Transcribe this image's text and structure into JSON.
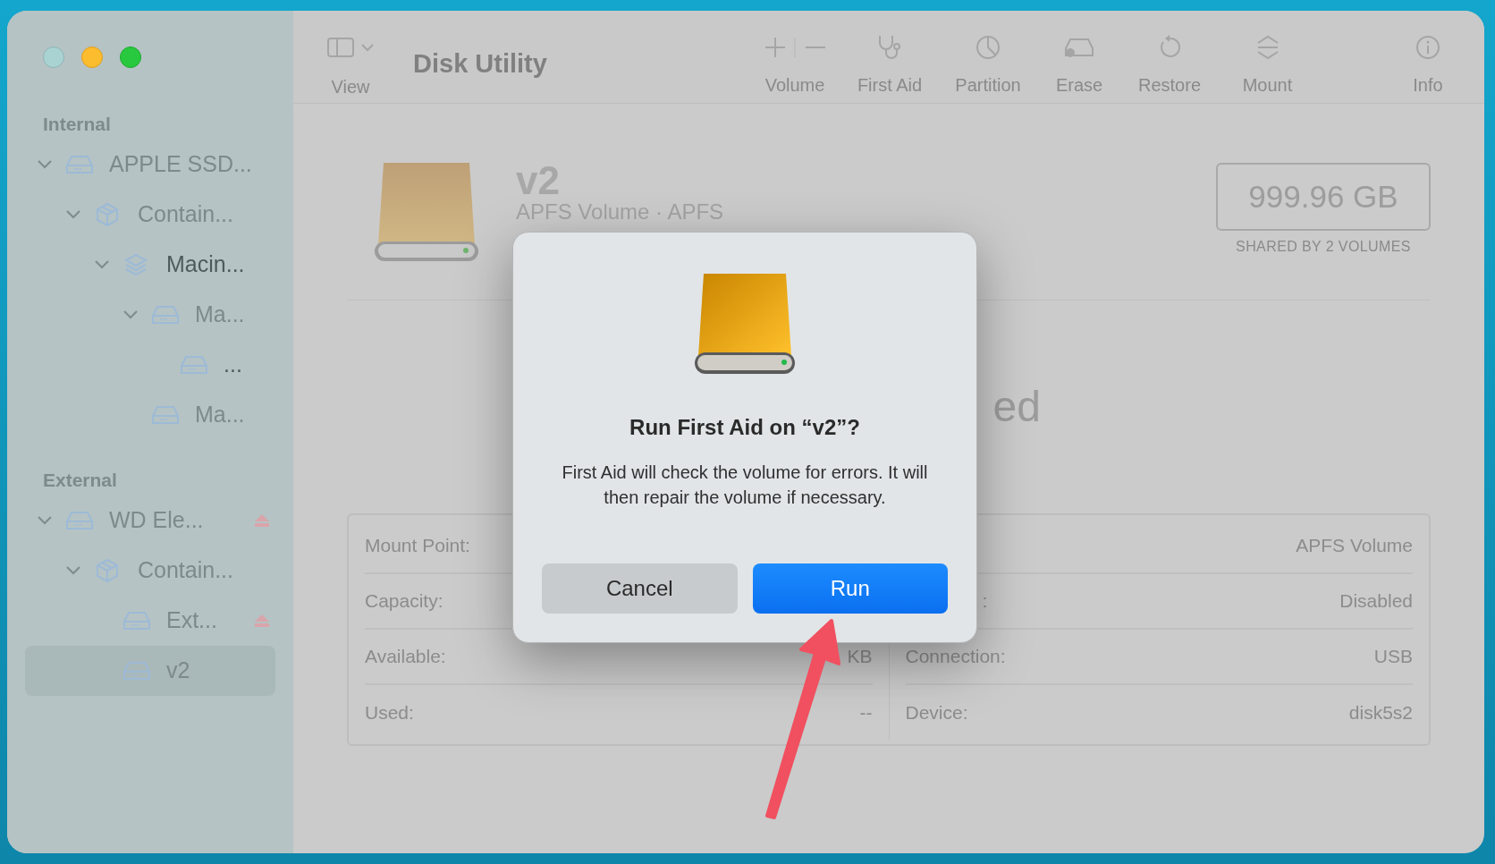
{
  "window": {
    "title": "Disk Utility"
  },
  "toolbar": {
    "view": {
      "label": "View"
    },
    "actions": [
      {
        "label": "Volume"
      },
      {
        "label": "First Aid"
      },
      {
        "label": "Partition"
      },
      {
        "label": "Erase"
      },
      {
        "label": "Restore"
      },
      {
        "label": "Mount"
      },
      {
        "label": "Info"
      }
    ]
  },
  "sidebar": {
    "sections": [
      {
        "title": "Internal",
        "items": [
          {
            "label": "APPLE SSD...",
            "kind": "disk",
            "expanded": true,
            "selected": false,
            "highlighted": false,
            "eject": false,
            "children": [
              {
                "label": "Contain...",
                "kind": "container",
                "expanded": true,
                "selected": false,
                "highlighted": false,
                "eject": false,
                "children": [
                  {
                    "label": "Macin...",
                    "kind": "layers",
                    "expanded": true,
                    "selected": false,
                    "highlighted": true,
                    "eject": false,
                    "children": [
                      {
                        "label": "Ma...",
                        "kind": "disk",
                        "expanded": true,
                        "selected": false,
                        "highlighted": false,
                        "eject": false,
                        "children": [
                          {
                            "label": "...",
                            "kind": "disk",
                            "selected": false,
                            "highlighted": true,
                            "eject": false
                          }
                        ]
                      },
                      {
                        "label": "Ma...",
                        "kind": "disk",
                        "selected": false,
                        "highlighted": false,
                        "eject": false
                      }
                    ]
                  }
                ]
              }
            ]
          }
        ]
      },
      {
        "title": "External",
        "items": [
          {
            "label": "WD Ele...",
            "kind": "disk",
            "expanded": true,
            "selected": false,
            "highlighted": false,
            "eject": true,
            "children": [
              {
                "label": "Contain...",
                "kind": "container",
                "expanded": true,
                "selected": false,
                "highlighted": false,
                "eject": false,
                "children": [
                  {
                    "label": "Ext...",
                    "kind": "disk",
                    "selected": false,
                    "highlighted": false,
                    "eject": true
                  },
                  {
                    "label": "v2",
                    "kind": "disk",
                    "selected": true,
                    "highlighted": false,
                    "eject": false
                  }
                ]
              }
            ]
          }
        ]
      }
    ]
  },
  "volume": {
    "name": "v2",
    "subtitle": "APFS Volume · APFS",
    "size": "999.96 GB",
    "size_note": "SHARED BY 2 VOLUMES",
    "status_fragment": "ed"
  },
  "info": {
    "left": [
      {
        "label": "Mount Point:"
      },
      {
        "label": "Capacity:"
      },
      {
        "label": "Available:",
        "value": "KB"
      },
      {
        "label": "Used:",
        "value": "--"
      }
    ],
    "right": [
      {
        "value": "APFS Volume"
      },
      {
        "label": ":",
        "value": "Disabled"
      },
      {
        "label": "Connection:",
        "value": "USB"
      },
      {
        "label": "Device:",
        "value": "disk5s2"
      }
    ]
  },
  "dialog": {
    "title": "Run First Aid on “v2”?",
    "message": "First Aid will check the volume for errors. It will then repair the volume if necessary.",
    "buttons": [
      {
        "label": "Cancel",
        "kind": "secondary"
      },
      {
        "label": "Run",
        "kind": "primary"
      }
    ]
  }
}
